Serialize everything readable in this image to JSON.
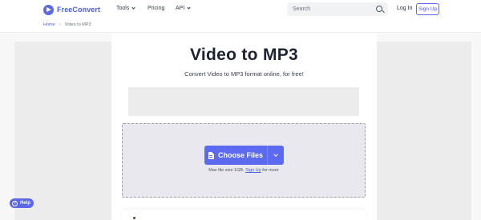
{
  "header": {
    "logo_text": "FreeConvert",
    "nav": [
      {
        "label": "Tools",
        "has_dropdown": true
      },
      {
        "label": "Pricing",
        "has_dropdown": false
      },
      {
        "label": "API",
        "has_dropdown": true
      }
    ],
    "search_placeholder": "Search",
    "login_label": "Log In",
    "signup_label": "Sign Up"
  },
  "breadcrumb": {
    "home": "Home",
    "current": "Video to MP3"
  },
  "main": {
    "title": "Video to MP3",
    "subtitle": "Convert Video to MP3 format online, for free!",
    "choose_files_label": "Choose Files",
    "max_size_prefix": "Max file size 1GB.",
    "signup_link": "Sign Up",
    "max_size_suffix": "for more"
  },
  "help": {
    "label": "Help",
    "icon_glyph": "?"
  },
  "colors": {
    "brand": "#5b67e6",
    "button": "#5b6af0",
    "dropzone_bg": "#e8e8ee",
    "ad_bg": "#ececec"
  },
  "icons": [
    "logo-icon",
    "chevron-down-icon",
    "search-icon",
    "file-icon",
    "question-icon"
  ]
}
